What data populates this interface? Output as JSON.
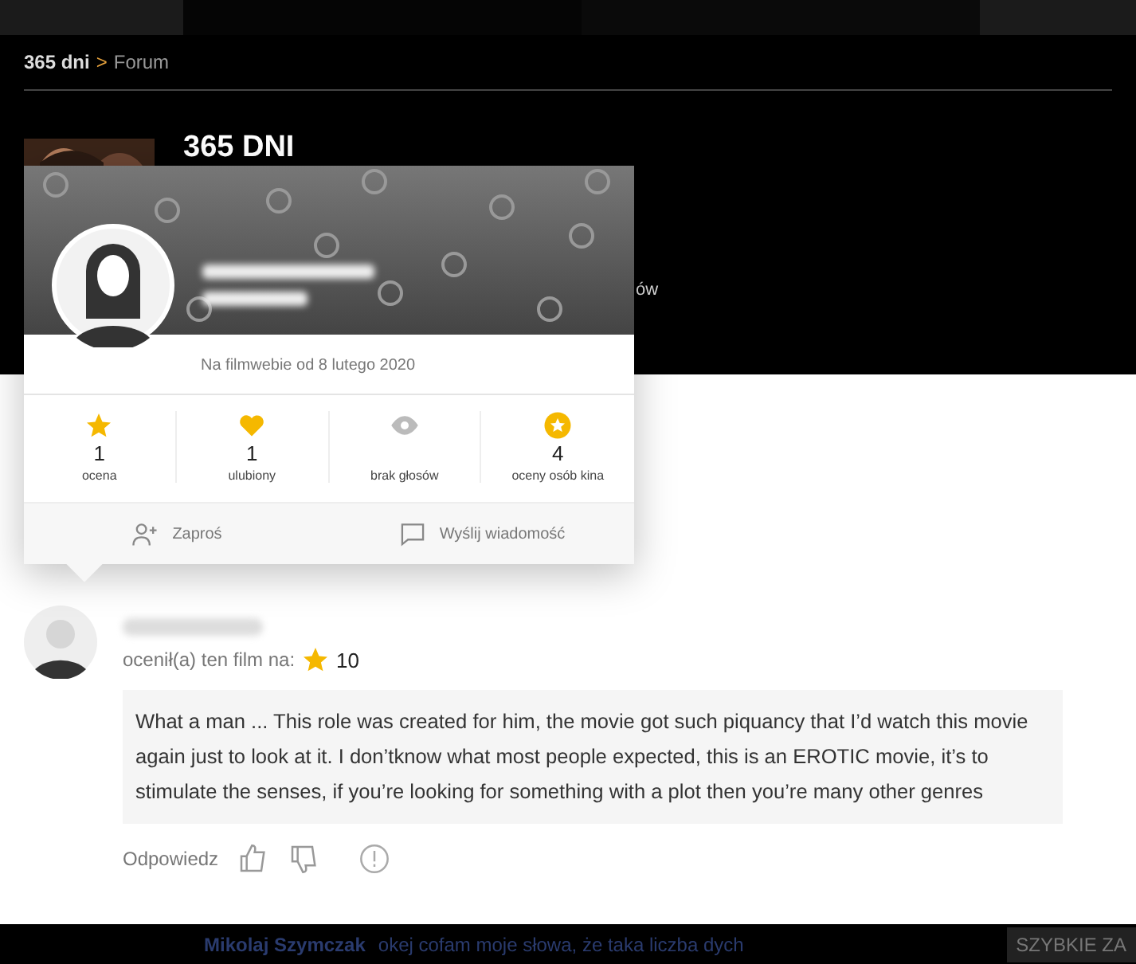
{
  "breadcrumb": {
    "items": [
      {
        "label": "365 dni"
      },
      {
        "label": "Forum"
      }
    ],
    "separator": ">"
  },
  "film": {
    "title": "365 DNI",
    "hidden_fragment": "ów"
  },
  "profile_popup": {
    "since": "Na filmwebie od 8 lutego 2020",
    "stats": [
      {
        "kind": "star",
        "value": "1",
        "label": "ocena"
      },
      {
        "kind": "heart",
        "value": "1",
        "label": "ulubiony"
      },
      {
        "kind": "eye",
        "label": "brak głosów"
      },
      {
        "kind": "badge",
        "value": "4",
        "label": "oceny osób kina"
      }
    ],
    "actions": [
      {
        "kind": "invite",
        "label": "Zaproś"
      },
      {
        "kind": "message",
        "label": "Wyślij wiadomość"
      }
    ]
  },
  "comment": {
    "rating_label": "ocenił(a) ten film na:",
    "rating": "10",
    "text": "What a man ... This role was created for him, the movie got such piquancy that I’d watch this movie again just to look at it. I don’tknow what most people expected, this is an EROTIC movie, it’s to stimulate the senses, if you’re looking for something with a plot then you’re many other genres",
    "reply": "Odpowiedz"
  },
  "bottom_bar": {
    "author": "Mikolaj Szymczak",
    "snippet": "okej cofam moje słowa, że taka liczba dych",
    "right": "SZYBKIE ZA"
  }
}
